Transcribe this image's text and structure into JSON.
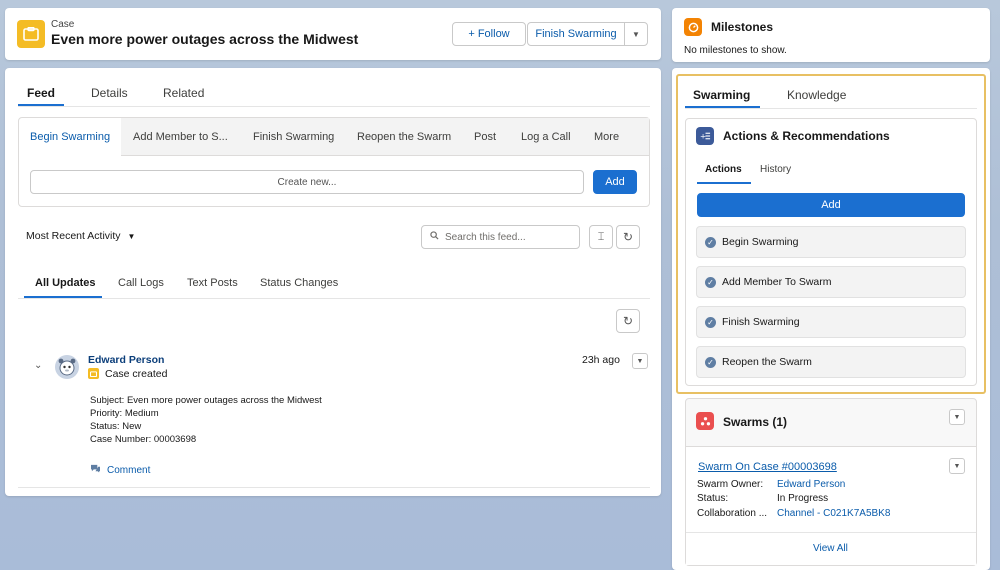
{
  "header": {
    "object_label": "Case",
    "title": "Even more power outages across the Midwest",
    "follow_label": "+ Follow",
    "finish_swarming_label": "Finish Swarming"
  },
  "tabs": [
    "Feed",
    "Details",
    "Related"
  ],
  "publisher": {
    "actions": [
      "Begin Swarming",
      "Add Member to S...",
      "Finish Swarming",
      "Reopen the Swarm",
      "Post",
      "Log a Call",
      "More"
    ],
    "create_placeholder": "Create new...",
    "add_label": "Add"
  },
  "feed": {
    "sort_label": "Most Recent Activity",
    "search_placeholder": "Search this feed...",
    "filters": [
      "All Updates",
      "Call Logs",
      "Text Posts",
      "Status Changes"
    ],
    "post": {
      "author": "Edward Person",
      "time": "23h ago",
      "event": "Case created",
      "subject": "Subject: Even more power outages across the Midwest",
      "priority": "Priority: Medium",
      "status": "Status: New",
      "case_number": "Case Number: 00003698",
      "comment_label": "Comment"
    }
  },
  "milestones": {
    "title": "Milestones",
    "empty": "No milestones to show."
  },
  "right_tabs": [
    "Swarming",
    "Knowledge"
  ],
  "actions_recs": {
    "title": "Actions & Recommendations",
    "tabs": [
      "Actions",
      "History"
    ],
    "add_label": "Add",
    "items": [
      "Begin Swarming",
      "Add Member To Swarm",
      "Finish Swarming",
      "Reopen the Swarm"
    ]
  },
  "swarms": {
    "title": "Swarms (1)",
    "record_link": "Swarm On Case #00003698",
    "owner_label": "Swarm Owner:",
    "owner_value": "Edward Person",
    "status_label": "Status:",
    "status_value": "In Progress",
    "collab_label": "Collaboration ...",
    "collab_value": "Channel - C021K7A5BK8",
    "view_all": "View All"
  },
  "colors": {
    "brand": "#1b6fd0",
    "case_icon": "#f4bc25",
    "milestone_icon": "#f38303",
    "actions_icon": "#3c5a99",
    "swarm_icon": "#ea4f4f",
    "highlight_border": "#e8c063"
  }
}
